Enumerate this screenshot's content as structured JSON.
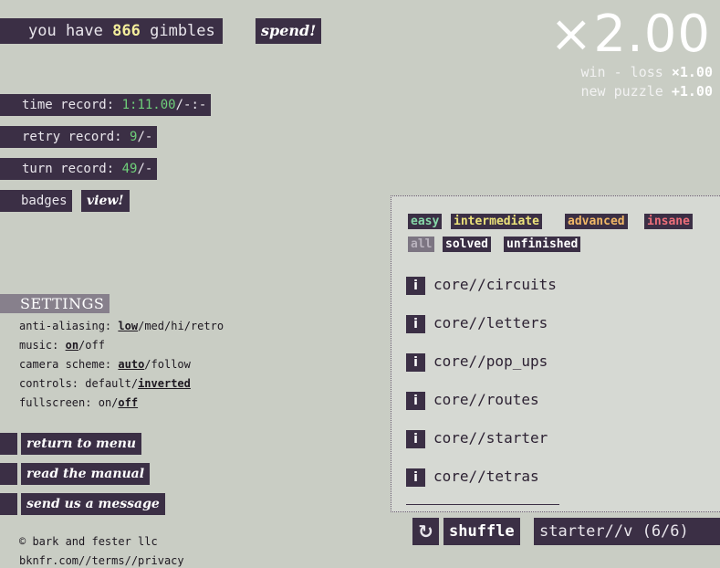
{
  "gimbles": {
    "prefix": "you have",
    "amount": "866",
    "suffix": "gimbles",
    "spend_label": "spend!"
  },
  "multiplier": {
    "value": "×2.00",
    "win_loss_label": "win - loss",
    "win_loss_value": "×1.00",
    "new_puzzle_label": "new puzzle",
    "new_puzzle_value": "+1.00"
  },
  "records": {
    "time_label": "time record:",
    "time_value": "1:11.00",
    "time_suffix": "/-:-",
    "retry_label": "retry record:",
    "retry_value": "9",
    "retry_suffix": "/-",
    "turn_label": "turn record:",
    "turn_value": "49",
    "turn_suffix": "/-"
  },
  "badges": {
    "label": "badges",
    "view_label": "view!"
  },
  "settings": {
    "header": "SETTINGS",
    "anti_aliasing": {
      "label": "anti-aliasing:",
      "options": [
        "low",
        "med",
        "hi",
        "retro"
      ],
      "selected": "low"
    },
    "music": {
      "label": "music:",
      "options": [
        "on",
        "off"
      ],
      "selected": "on"
    },
    "camera": {
      "label": "camera scheme:",
      "options": [
        "auto",
        "follow"
      ],
      "selected": "auto"
    },
    "controls": {
      "label": "controls:",
      "options": [
        "default",
        "inverted"
      ],
      "selected": "inverted"
    },
    "fullscreen": {
      "label": "fullscreen:",
      "options": [
        "on",
        "off"
      ],
      "selected": "off"
    }
  },
  "menu_buttons": {
    "return": "return to menu",
    "manual": "read the manual",
    "message": "send us a message"
  },
  "footer": {
    "copyright": "© bark and fester llc",
    "link": "bknfr.com//terms//privacy"
  },
  "filters": {
    "difficulty": [
      {
        "label": "easy",
        "color": "#86d7a8"
      },
      {
        "label": "intermediate",
        "color": "#ece27a"
      },
      {
        "label": "advanced",
        "color": "#f0b766"
      },
      {
        "label": "insane",
        "color": "#ee6f7a"
      }
    ],
    "status": [
      {
        "label": "all",
        "active": false
      },
      {
        "label": "solved",
        "active": true
      },
      {
        "label": "unfinished",
        "active": true
      }
    ]
  },
  "puzzles": [
    {
      "info": "i",
      "name": "core//circuits"
    },
    {
      "info": "i",
      "name": "core//letters"
    },
    {
      "info": "i",
      "name": "core//pop_ups"
    },
    {
      "info": "i",
      "name": "core//routes"
    },
    {
      "info": "i",
      "name": "core//starter"
    },
    {
      "info": "i",
      "name": "core//tetras"
    }
  ],
  "bottom_bar": {
    "reload_icon": "↻",
    "shuffle_label": "shuffle",
    "current": "starter//v (6/6)"
  }
}
